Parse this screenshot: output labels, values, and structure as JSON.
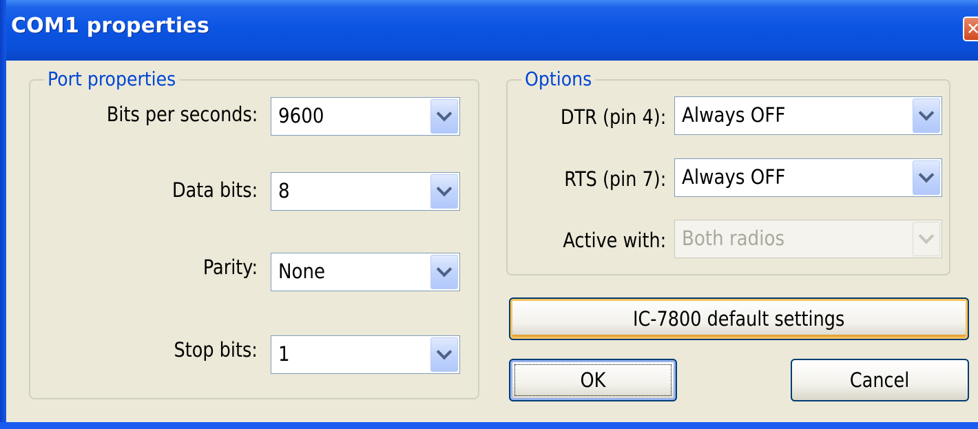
{
  "window": {
    "title": "COM1 properties",
    "close_glyph": "✕"
  },
  "port_properties": {
    "legend": "Port properties",
    "fields": [
      {
        "label": "Bits per seconds:",
        "value": "9600"
      },
      {
        "label": "Data bits:",
        "value": "8"
      },
      {
        "label": "Parity:",
        "value": "None"
      },
      {
        "label": "Stop bits:",
        "value": "1"
      }
    ]
  },
  "options": {
    "legend": "Options",
    "fields": [
      {
        "label": "DTR (pin 4):",
        "value": "Always OFF",
        "enabled": true
      },
      {
        "label": "RTS (pin 7):",
        "value": "Always OFF",
        "enabled": true
      },
      {
        "label": "Active with:",
        "value": "Both radios",
        "enabled": false
      }
    ]
  },
  "buttons": {
    "defaults": "IC-7800 default settings",
    "ok": "OK",
    "cancel": "Cancel"
  },
  "colors": {
    "titlebar": "#0a4fd9",
    "legend_text": "#0046d5",
    "button_border": "#003c74",
    "hot_highlight": "#f8c45e"
  },
  "icons": [
    "close-icon",
    "chevron-down-icon"
  ]
}
